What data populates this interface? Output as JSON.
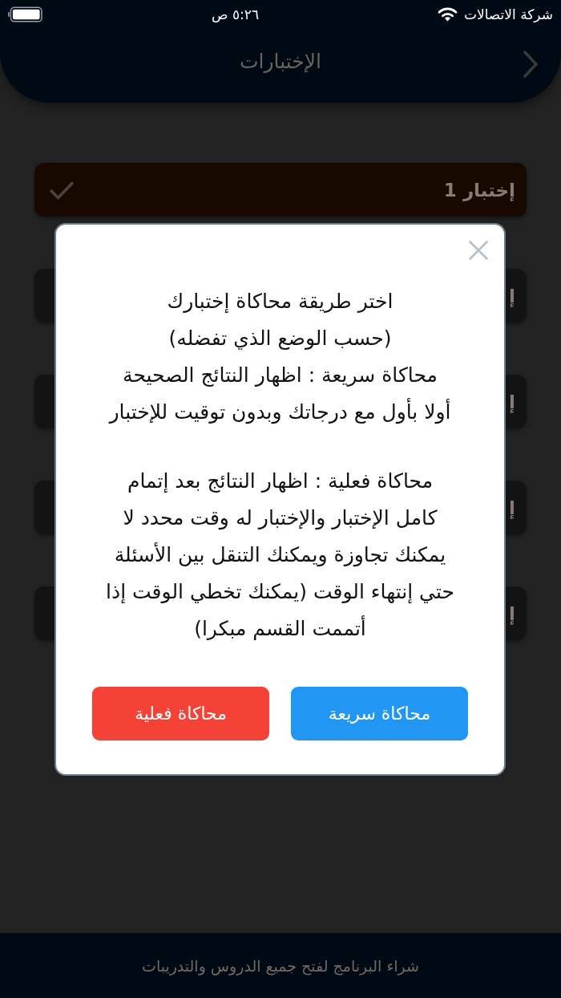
{
  "status_bar": {
    "carrier": "شركة الاتصالات",
    "time": "٥:٢٦ ص"
  },
  "header": {
    "title": "الإختبارات"
  },
  "quizzes": [
    {
      "title": "إختبار 1",
      "completed": true
    },
    {
      "title": "إ",
      "completed": false
    },
    {
      "title": "إ",
      "completed": false
    },
    {
      "title": "إ",
      "completed": false
    },
    {
      "title": "إ",
      "completed": false
    }
  ],
  "dialog": {
    "paragraphs": [
      "اختر طريقة محاكاة إختبارك\n(حسب الوضع الذي تفضله)\nمحاكاة سريعة : اظهار النتائج الصحيحة\nأولا بأول مع درجاتك وبدون توقيت للإختبار",
      "محاكاة فعلية : اظهار النتائج بعد إتمام\nكامل الإختبار والإختبار له وقت محدد لا\nيمكنك تجاوزة ويمكنك التنقل بين الأسئلة\nحتي إنتهاء الوقت (يمكنك تخطي الوقت إذا\nأتممت القسم مبكرا)"
    ],
    "buttons": [
      {
        "label": "محاكاة سريعة",
        "color": "#2196f3"
      },
      {
        "label": "محاكاة فعلية",
        "color": "#f44336"
      }
    ]
  },
  "footer": {
    "text": "شراء البرنامج لفتح جميع الدروس والتدريبات"
  }
}
